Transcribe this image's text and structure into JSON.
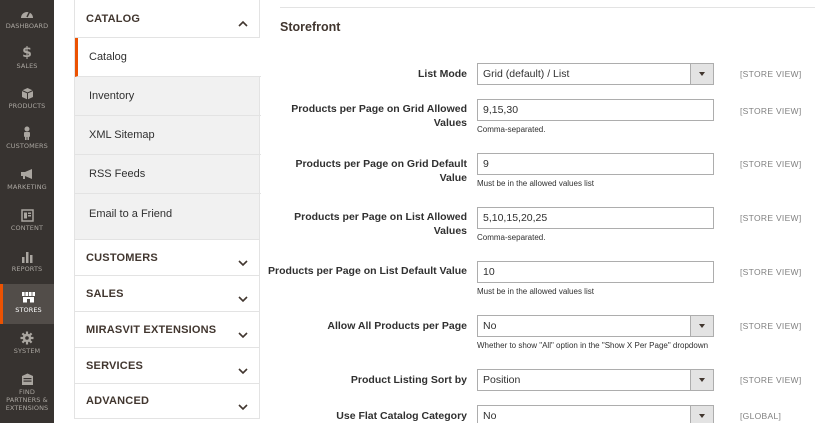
{
  "admin_menu": [
    {
      "label": "Dashboard",
      "icon": "dashboard-icon"
    },
    {
      "label": "Sales",
      "icon": "dollar-icon"
    },
    {
      "label": "Products",
      "icon": "box-icon"
    },
    {
      "label": "Customers",
      "icon": "person-icon"
    },
    {
      "label": "Marketing",
      "icon": "megaphone-icon"
    },
    {
      "label": "Content",
      "icon": "content-icon"
    },
    {
      "label": "Reports",
      "icon": "bar-chart-icon"
    },
    {
      "label": "Stores",
      "icon": "store-icon",
      "active": true
    },
    {
      "label": "System",
      "icon": "gear-icon"
    },
    {
      "label": "Find Partners & Extensions",
      "icon": "partners-icon"
    }
  ],
  "config_tabs": {
    "catalog": {
      "title": "CATALOG",
      "items": [
        "Catalog",
        "Inventory",
        "XML Sitemap",
        "RSS Feeds",
        "Email to a Friend"
      ],
      "active": "Catalog"
    },
    "groups": [
      "CUSTOMERS",
      "SALES",
      "MIRASVIT EXTENSIONS",
      "SERVICES",
      "ADVANCED"
    ]
  },
  "section": {
    "title": "Storefront",
    "rows": [
      {
        "label": "List Mode",
        "type": "select",
        "value": "Grid (default) / List",
        "scope": "[STORE VIEW]"
      },
      {
        "label": "Products per Page on Grid Allowed Values",
        "type": "input",
        "value": "9,15,30",
        "note": "Comma-separated.",
        "scope": "[STORE VIEW]"
      },
      {
        "label": "Products per Page on Grid Default Value",
        "type": "input",
        "value": "9",
        "note": "Must be in the allowed values list",
        "scope": "[STORE VIEW]"
      },
      {
        "label": "Products per Page on List Allowed Values",
        "type": "input",
        "value": "5,10,15,20,25",
        "note": "Comma-separated.",
        "scope": "[STORE VIEW]"
      },
      {
        "label": "Products per Page on List Default Value",
        "type": "input",
        "value": "10",
        "note": "Must be in the allowed values list",
        "scope": "[STORE VIEW]"
      },
      {
        "label": "Allow All Products per Page",
        "type": "select",
        "value": "No",
        "note": "Whether to show \"All\" option in the \"Show X Per Page\" dropdown",
        "scope": "[STORE VIEW]"
      },
      {
        "label": "Product Listing Sort by",
        "type": "select",
        "value": "Position",
        "scope": "[STORE VIEW]"
      },
      {
        "label": "Use Flat Catalog Category",
        "type": "select",
        "value": "No",
        "scope": "[GLOBAL]"
      }
    ]
  },
  "colors": {
    "menu_bg": "#373330",
    "accent": "#eb5202",
    "tab_bg": "#f1f1f1"
  }
}
